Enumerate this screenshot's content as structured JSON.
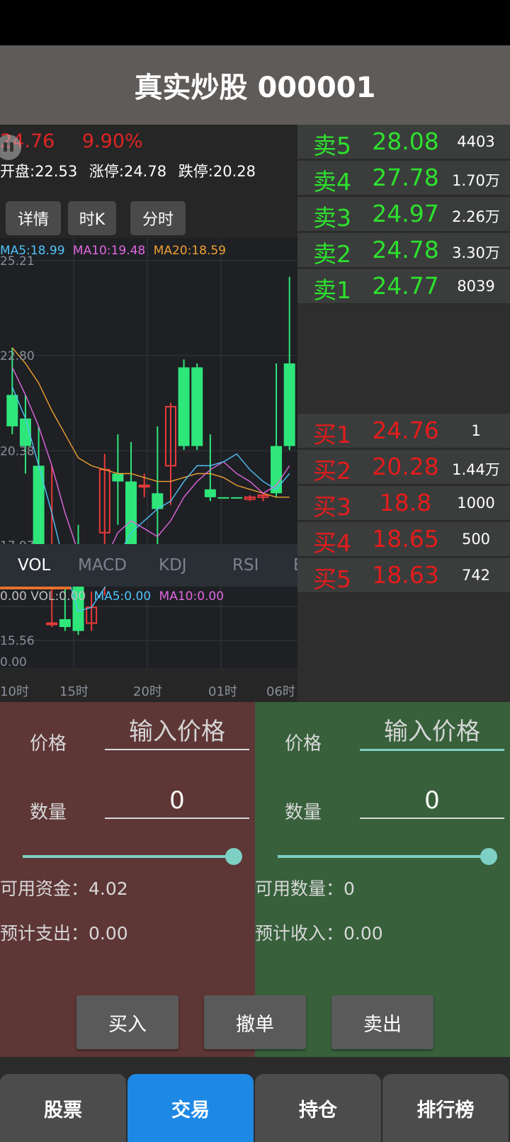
{
  "title": "真实炒股 000001",
  "stock": {
    "price": "24.76",
    "change_pct": "9.90%",
    "open": "开盘:22.53",
    "limit_up": "涨停:24.78",
    "limit_down": "跌停:20.28"
  },
  "chart_buttons": [
    "详情",
    "时K",
    "分时"
  ],
  "ma_legend": {
    "ma5": "MA5:18.99",
    "ma10": "MA10:19.48",
    "ma20": "MA20:18.59",
    "ma5_color": "#4fc3f7",
    "ma10_color": "#e266e0",
    "ma20_color": "#f0a030"
  },
  "chart_data": {
    "type": "candlestick",
    "y_ticks": [
      "25.21",
      "22.80",
      "20.38",
      "17.97",
      "15.56"
    ],
    "ylim": [
      15.56,
      25.21
    ],
    "x_ticks": [
      "10时",
      "15时",
      "20时",
      "01时",
      "06时"
    ],
    "candles": [
      {
        "o": 21.0,
        "c": 21.8,
        "h": 23.0,
        "l": 20.8,
        "up": false
      },
      {
        "o": 20.5,
        "c": 21.2,
        "h": 21.8,
        "l": 19.8,
        "up": false
      },
      {
        "o": 20.0,
        "c": 18.0,
        "h": 21.0,
        "l": 17.9,
        "up": false
      },
      {
        "o": 16.0,
        "c": 16.0,
        "h": 20.0,
        "l": 15.9,
        "up": true
      },
      {
        "o": 15.9,
        "c": 16.1,
        "h": 18.0,
        "l": 15.8,
        "up": false
      },
      {
        "o": 17.5,
        "c": 15.8,
        "h": 18.5,
        "l": 15.7,
        "up": false
      },
      {
        "o": 16.0,
        "c": 16.4,
        "h": 16.8,
        "l": 15.8,
        "up": true
      },
      {
        "o": 18.3,
        "c": 19.9,
        "h": 20.3,
        "l": 16.7,
        "up": true
      },
      {
        "o": 19.8,
        "c": 19.6,
        "h": 20.8,
        "l": 18.5,
        "up": false
      },
      {
        "o": 19.6,
        "c": 17.6,
        "h": 20.6,
        "l": 17.5,
        "up": false
      },
      {
        "o": 19.5,
        "c": 19.5,
        "h": 19.8,
        "l": 19.2,
        "up": true
      },
      {
        "o": 19.3,
        "c": 18.9,
        "h": 21.0,
        "l": 17.4,
        "up": false
      },
      {
        "o": 20.0,
        "c": 21.5,
        "h": 21.6,
        "l": 19.0,
        "up": true
      },
      {
        "o": 22.5,
        "c": 20.5,
        "h": 22.7,
        "l": 20.4,
        "up": false
      },
      {
        "o": 22.5,
        "c": 20.5,
        "h": 22.6,
        "l": 20.4,
        "up": false
      },
      {
        "o": 19.4,
        "c": 19.2,
        "h": 20.8,
        "l": 19.1,
        "up": false
      },
      {
        "o": 19.2,
        "c": 19.2,
        "h": 19.2,
        "l": 19.2,
        "up": false
      },
      {
        "o": 19.2,
        "c": 19.2,
        "h": 19.2,
        "l": 19.2,
        "up": false
      },
      {
        "o": 19.15,
        "c": 19.2,
        "h": 19.25,
        "l": 19.1,
        "up": true
      },
      {
        "o": 19.2,
        "c": 19.25,
        "h": 19.3,
        "l": 19.1,
        "up": true
      },
      {
        "o": 20.5,
        "c": 19.3,
        "h": 22.6,
        "l": 19.2,
        "up": false
      },
      {
        "o": 22.6,
        "c": 20.5,
        "h": 24.8,
        "l": 20.4,
        "up": false
      }
    ],
    "ma5": [
      22.0,
      21.2,
      20.0,
      18.8,
      17.4,
      16.3,
      16.4,
      16.9,
      17.7,
      18.3,
      18.6,
      18.9,
      19.1,
      19.6,
      20.0,
      20.0,
      20.1,
      20.3,
      19.9,
      19.6,
      19.4,
      19.8
    ],
    "ma10": [
      22.5,
      21.8,
      21.0,
      20.0,
      18.8,
      17.8,
      17.2,
      17.6,
      18.3,
      18.6,
      18.4,
      18.2,
      18.6,
      19.2,
      19.6,
      19.9,
      20.1,
      19.8,
      19.6,
      19.3,
      19.5,
      20.0
    ],
    "ma20": [
      23.0,
      22.6,
      22.1,
      21.4,
      20.8,
      20.2,
      20.0,
      19.9,
      19.8,
      19.8,
      19.7,
      19.6,
      19.6,
      19.7,
      19.8,
      19.8,
      19.7,
      19.5,
      19.4,
      19.3,
      19.2,
      19.2
    ]
  },
  "indicator_tabs": [
    "VOL",
    "MACD",
    "KDJ",
    "RSI",
    "B"
  ],
  "vol_legend": {
    "vol": "0.00 VOL:0.00",
    "ma5": "MA5:0.00",
    "ma10": "MA10:0.00",
    "zero": "0.00"
  },
  "order_book": {
    "asks": [
      {
        "label": "卖5",
        "price": "28.08",
        "volume": "4403"
      },
      {
        "label": "卖4",
        "price": "27.78",
        "volume": "1.70万"
      },
      {
        "label": "卖3",
        "price": "24.97",
        "volume": "2.26万"
      },
      {
        "label": "卖2",
        "price": "24.78",
        "volume": "3.30万"
      },
      {
        "label": "卖1",
        "price": "24.77",
        "volume": "8039"
      }
    ],
    "bids": [
      {
        "label": "买1",
        "price": "24.76",
        "volume": "1"
      },
      {
        "label": "买2",
        "price": "20.28",
        "volume": "1.44万"
      },
      {
        "label": "买3",
        "price": "18.8",
        "volume": "1000"
      },
      {
        "label": "买4",
        "price": "18.65",
        "volume": "500"
      },
      {
        "label": "买5",
        "price": "18.63",
        "volume": "742"
      }
    ]
  },
  "buy_form": {
    "price_label": "价格",
    "price_placeholder": "输入价格",
    "qty_label": "数量",
    "qty_value": "0",
    "available": "可用资金：4.02",
    "estimate": "预计支出：0.00"
  },
  "sell_form": {
    "price_label": "价格",
    "price_placeholder": "输入价格",
    "qty_label": "数量",
    "qty_value": "0",
    "available": "可用数量：0",
    "estimate": "预计收入：0.00"
  },
  "actions": {
    "buy": "买入",
    "cancel": "撤单",
    "sell": "卖出"
  },
  "nav": [
    "股票",
    "交易",
    "持仓",
    "排行榜"
  ]
}
